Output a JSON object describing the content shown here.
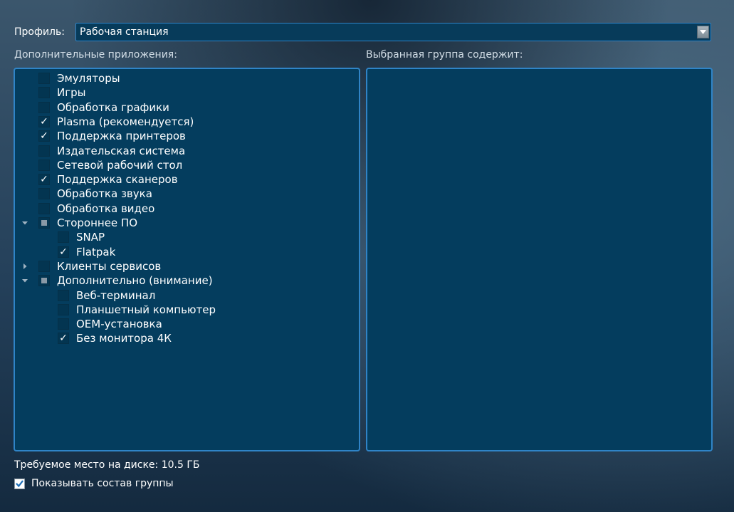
{
  "profile": {
    "label": "Профиль:",
    "value": "Рабочая станция"
  },
  "apps_label": "Дополнительные приложения:",
  "group_label": "Выбранная группа содержит:",
  "tree": [
    {
      "label": "Эмуляторы",
      "state": "unchecked",
      "level": 0,
      "expander": "none"
    },
    {
      "label": "Игры",
      "state": "unchecked",
      "level": 0,
      "expander": "none"
    },
    {
      "label": "Обработка графики",
      "state": "unchecked",
      "level": 0,
      "expander": "none"
    },
    {
      "label": "Plasma (рекомендуется)",
      "state": "checked",
      "level": 0,
      "expander": "none"
    },
    {
      "label": "Поддержка принтеров",
      "state": "checked",
      "level": 0,
      "expander": "none"
    },
    {
      "label": "Издательская система",
      "state": "unchecked",
      "level": 0,
      "expander": "none"
    },
    {
      "label": "Сетевой рабочий стол",
      "state": "unchecked",
      "level": 0,
      "expander": "none"
    },
    {
      "label": "Поддержка сканеров",
      "state": "checked",
      "level": 0,
      "expander": "none"
    },
    {
      "label": "Обработка звука",
      "state": "unchecked",
      "level": 0,
      "expander": "none"
    },
    {
      "label": "Обработка видео",
      "state": "unchecked",
      "level": 0,
      "expander": "none"
    },
    {
      "label": "Стороннее ПО",
      "state": "partial",
      "level": 0,
      "expander": "expanded"
    },
    {
      "label": "SNAP",
      "state": "unchecked",
      "level": 1,
      "expander": "none"
    },
    {
      "label": "Flatpak",
      "state": "checked",
      "level": 1,
      "expander": "none"
    },
    {
      "label": "Клиенты сервисов",
      "state": "unchecked",
      "level": 0,
      "expander": "collapsed"
    },
    {
      "label": "Дополнительно (внимание)",
      "state": "partial",
      "level": 0,
      "expander": "expanded"
    },
    {
      "label": "Веб-терминал",
      "state": "unchecked",
      "level": 1,
      "expander": "none"
    },
    {
      "label": "Планшетный компьютер",
      "state": "unchecked",
      "level": 1,
      "expander": "none"
    },
    {
      "label": "OEM-установка",
      "state": "unchecked",
      "level": 1,
      "expander": "none"
    },
    {
      "label": "Без монитора 4К",
      "state": "checked",
      "level": 1,
      "expander": "none"
    }
  ],
  "check_glyph": "✓",
  "disk_space": "Требуемое место на диске: 10.5 ГБ",
  "show_group": {
    "label": "Показывать состав группы",
    "checked": true
  },
  "colors": {
    "panel_bg": "#043d5e",
    "panel_border": "#2f84c7",
    "checkbox_bg": "#033551"
  },
  "icons": {
    "combo_arrow": "chevron-down-icon",
    "expanded": "triangle-down-icon",
    "collapsed": "triangle-right-icon",
    "check": "checkmark-icon"
  }
}
